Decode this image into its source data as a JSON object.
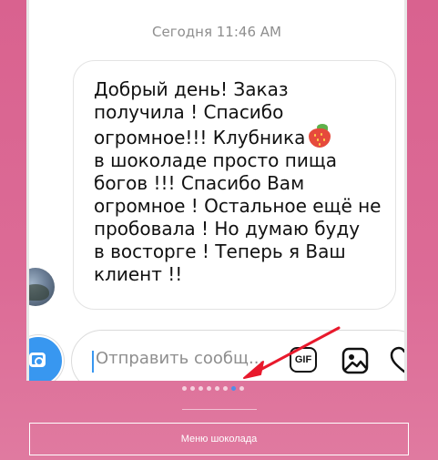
{
  "chat": {
    "timestamp": "Сегодня 11:46 AM",
    "message_lines": [
      "Добрый день! Заказ",
      "получила ! Спасибо",
      "огромное!!! Клубника",
      "в шоколаде просто пища",
      "богов !!! Спасибо Вам",
      "огромное ! Остальное ещё не",
      "пробовала ! Но думаю буду",
      "в восторге ! Теперь я Ваш",
      "клиент !!"
    ],
    "emoji": "strawberry-icon"
  },
  "composer": {
    "placeholder": "Отправить сообщ...",
    "gif_label": "GIF"
  },
  "carousel": {
    "dot_count": 8,
    "active_index": 6
  },
  "menu_button": {
    "label": "Меню шоколада"
  },
  "colors": {
    "accent": "#3897f0",
    "arrow": "#e8192c",
    "background": "#d9628f"
  }
}
